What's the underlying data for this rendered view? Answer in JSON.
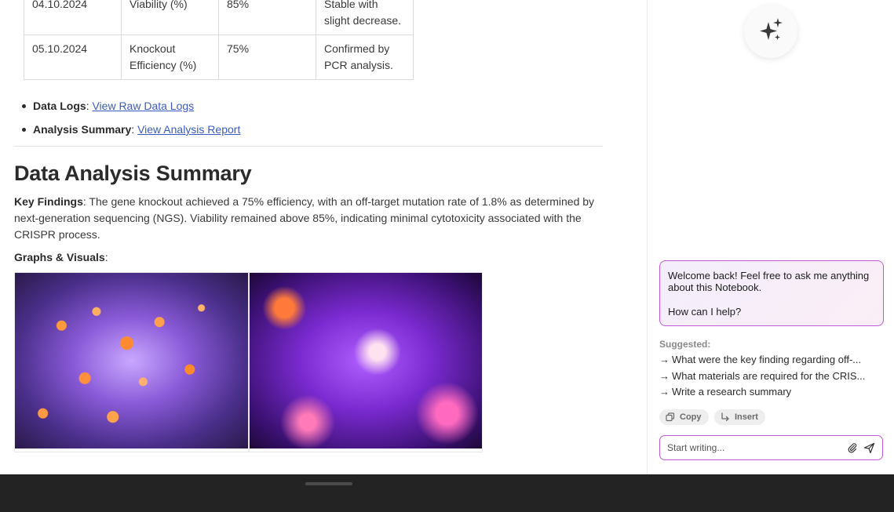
{
  "table": {
    "rows": [
      {
        "date": "04.10.2024",
        "metric": "Viability (%)",
        "value": "85%",
        "notes": "Stable with slight decrease."
      },
      {
        "date": "05.10.2024",
        "metric": "Knockout Efficiency (%)",
        "value": "75%",
        "notes": "Confirmed by PCR analysis."
      }
    ]
  },
  "links": [
    {
      "label": "Data Logs",
      "link_text": "View Raw Data Logs"
    },
    {
      "label": "Analysis Summary",
      "link_text": "View Analysis Report"
    }
  ],
  "section": {
    "title": "Data Analysis Summary",
    "key_findings_label": "Key Findings",
    "key_findings_text": ": The gene knockout achieved a 75% efficiency, with an off-target mutation rate of 1.8% as determined by next-generation sequencing (NGS). Viability remained above 85%, indicating minimal cytotoxicity associated with the CRISPR process.",
    "graphs_label": "Graphs & Visuals",
    "graphs_colon": ":"
  },
  "images": [
    {
      "icon": "cell-microscopy-image-orange-purple"
    },
    {
      "icon": "neuron-microscopy-image-purple-pink"
    }
  ],
  "assistant": {
    "orb_icon": "sparkles-icon",
    "welcome_line1": "Welcome back! Feel free to ask me anything about this Notebook.",
    "welcome_line2": "How can I help?",
    "suggested_label": "Suggested:",
    "arrow": "→",
    "suggestions": [
      "What were the key finding regarding off-...",
      "What materials are required for the CRIS...",
      "Write a research summary"
    ],
    "copy_label": "Copy",
    "insert_label": "Insert",
    "input_placeholder": "Start writing...",
    "accent_color": "#c05ad8"
  },
  "colors": {
    "link": "#3b5cc6",
    "bottom_bar": "#232323"
  }
}
